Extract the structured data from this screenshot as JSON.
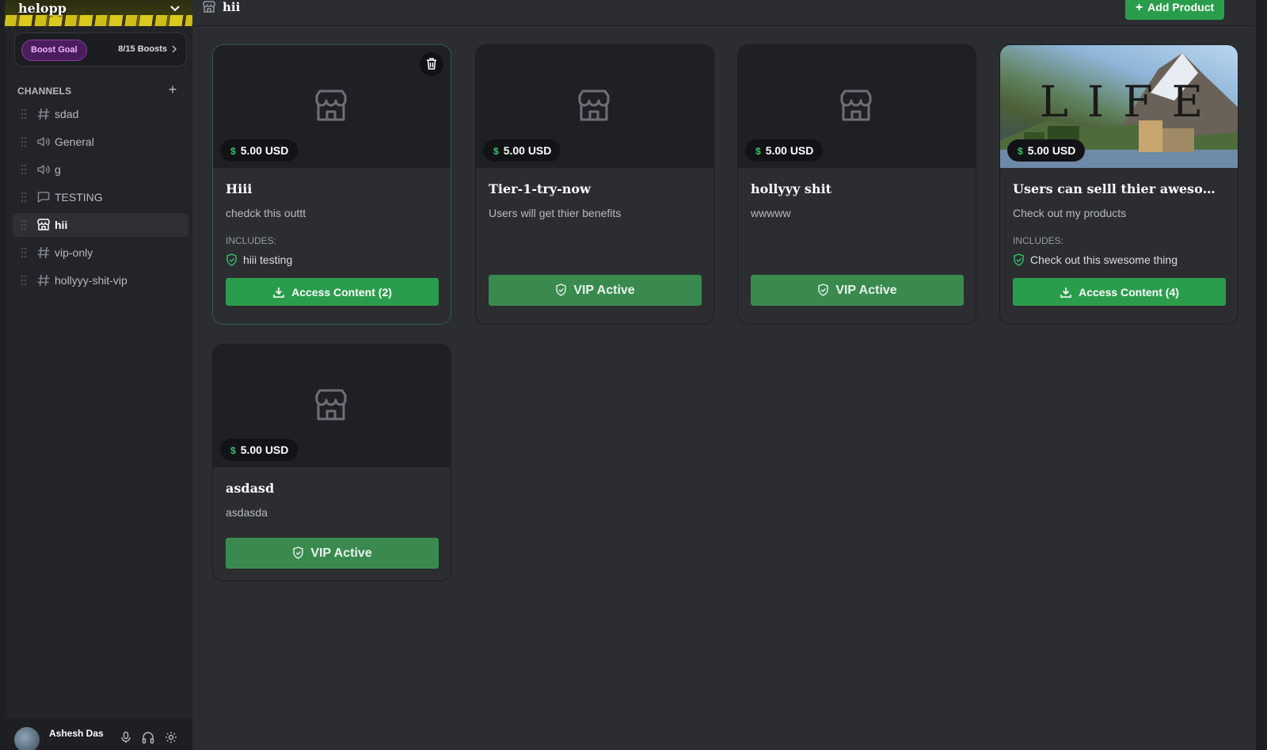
{
  "server": {
    "name": "helopp"
  },
  "boost": {
    "label": "Boost Goal",
    "count": "8/15 Boosts"
  },
  "channels": {
    "header": "CHANNELS",
    "add": "+",
    "items": [
      {
        "label": "sdad",
        "icon": "hash-icon"
      },
      {
        "label": "General",
        "icon": "speaker-icon"
      },
      {
        "label": "g",
        "icon": "speaker-icon"
      },
      {
        "label": "TESTING",
        "icon": "chat-bubble-icon"
      },
      {
        "label": "hii",
        "icon": "store-icon",
        "active": true
      },
      {
        "label": "vip-only",
        "icon": "hash-icon"
      },
      {
        "label": "hollyyy-shit-vip",
        "icon": "hash-icon"
      }
    ]
  },
  "user": {
    "name": "Ashesh Das"
  },
  "topbar": {
    "title": "hii",
    "add_product": "Add Product"
  },
  "products": [
    {
      "price": "5.00 USD",
      "title": "Hiii",
      "description": "chedck this outtt",
      "includes_label": "INCLUDES:",
      "include_item": "hiii testing",
      "button": "Access Content (2)"
    },
    {
      "price": "5.00 USD",
      "title": "Tier-1-try-now",
      "description": "Users will get thier benefits",
      "button": "VIP Active"
    },
    {
      "price": "5.00 USD",
      "title": "hollyyy shit",
      "description": "wwwww",
      "button": "VIP Active"
    },
    {
      "price": "5.00 USD",
      "title": "Users can selll thier awesome...",
      "description": "Check out my products",
      "includes_label": "INCLUDES:",
      "include_item": "Check out this swesome thing",
      "button": "Access Content (4)",
      "image_text": "LIFE"
    },
    {
      "price": "5.00 USD",
      "title": "asdasd",
      "description": "asdasda",
      "button": "VIP Active"
    }
  ],
  "colors": {
    "accent_green": "#2a9d4c",
    "boost_purple": "#8a3ca5"
  }
}
